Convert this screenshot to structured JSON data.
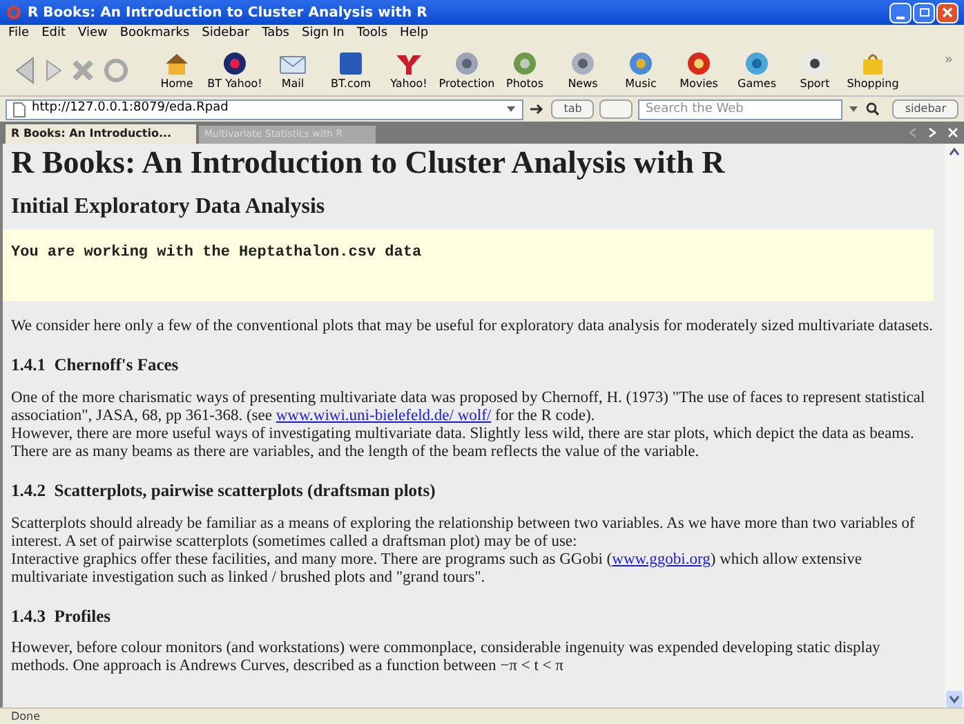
{
  "window": {
    "title": "R Books: An Introduction to Cluster Analysis with R"
  },
  "menu": [
    "File",
    "Edit",
    "View",
    "Bookmarks",
    "Sidebar",
    "Tabs",
    "Sign In",
    "Tools",
    "Help"
  ],
  "toolbar": [
    {
      "label": "Home",
      "kind": "home"
    },
    {
      "label": "BT Yahoo!",
      "kind": "bt-yahoo"
    },
    {
      "label": "Mail",
      "kind": "mail"
    },
    {
      "label": "BT.com",
      "kind": "bt"
    },
    {
      "label": "Yahoo!",
      "kind": "yahoo"
    },
    {
      "label": "Protection",
      "kind": "protection"
    },
    {
      "label": "Photos",
      "kind": "photos"
    },
    {
      "label": "News",
      "kind": "news"
    },
    {
      "label": "Music",
      "kind": "music"
    },
    {
      "label": "Movies",
      "kind": "movies"
    },
    {
      "label": "Games",
      "kind": "games"
    },
    {
      "label": "Sport",
      "kind": "sport"
    },
    {
      "label": "Shopping",
      "kind": "shopping"
    }
  ],
  "toolbar_more": "»",
  "address": {
    "url": "http://127.0.0.1:8079/eda.Rpad",
    "tab_button": "tab",
    "search_placeholder": "Search the Web",
    "sidebar_button": "sidebar"
  },
  "tabs": [
    {
      "label": "R Books: An Introductio...",
      "selected": true
    },
    {
      "label": "Multivariate Statistics with R",
      "selected": false
    }
  ],
  "page": {
    "title": "R Books: An Introduction to Cluster Analysis with R",
    "subtitle": "Initial Exploratory Data Analysis",
    "output": "You are working with the Heptathalon.csv data",
    "blocks": [
      {
        "kind": "para",
        "lines": [
          [
            {
              "text": "We consider here only a few of the conventional plots that may be useful for exploratory data analysis for moderately sized multivariate datasets."
            }
          ]
        ]
      },
      {
        "kind": "heading",
        "number": "1.4.1",
        "text": "Chernoff's Faces"
      },
      {
        "kind": "para",
        "lines": [
          [
            {
              "text": "One of the more charismatic ways of presenting multivariate data was proposed by Chernoff, H. (1973) \"The use of faces to represent statistical association\", JASA, 68, pp 361-368. (see "
            },
            {
              "text": "www.wiwi.uni-bielefeld.de/ wolf/",
              "link": true
            },
            {
              "text": " for the R code)."
            }
          ],
          [
            {
              "text": "However, there are more useful ways of investigating multivariate data. Slightly less wild, there are star plots, which depict the data as beams. There are as many beams as there are variables, and the length of the beam reflects the value of the variable."
            }
          ]
        ]
      },
      {
        "kind": "heading",
        "number": "1.4.2",
        "text": "Scatterplots, pairwise scatterplots (draftsman plots)"
      },
      {
        "kind": "para",
        "lines": [
          [
            {
              "text": "Scatterplots should already be familiar as a means of exploring the relationship between two variables. As we have more than two variables of interest. A set of pairwise scatterplots (sometimes called a draftsman plot) may be of use:"
            }
          ],
          [
            {
              "text": "Interactive graphics offer these facilities, and many more. There are programs such as GGobi ("
            },
            {
              "text": "www.ggobi.org",
              "link": true
            },
            {
              "text": ") which allow extensive multivariate investigation such as linked / brushed plots and \"grand tours\"."
            }
          ]
        ]
      },
      {
        "kind": "heading",
        "number": "1.4.3",
        "text": "Profiles"
      },
      {
        "kind": "para",
        "lines": [
          [
            {
              "text": "However, before colour monitors (and workstations) were commonplace, considerable ingenuity was expended developing static display methods. One approach is Andrews Curves, described as a function between −π < t < π"
            }
          ]
        ]
      }
    ]
  },
  "status_bar": "Done"
}
